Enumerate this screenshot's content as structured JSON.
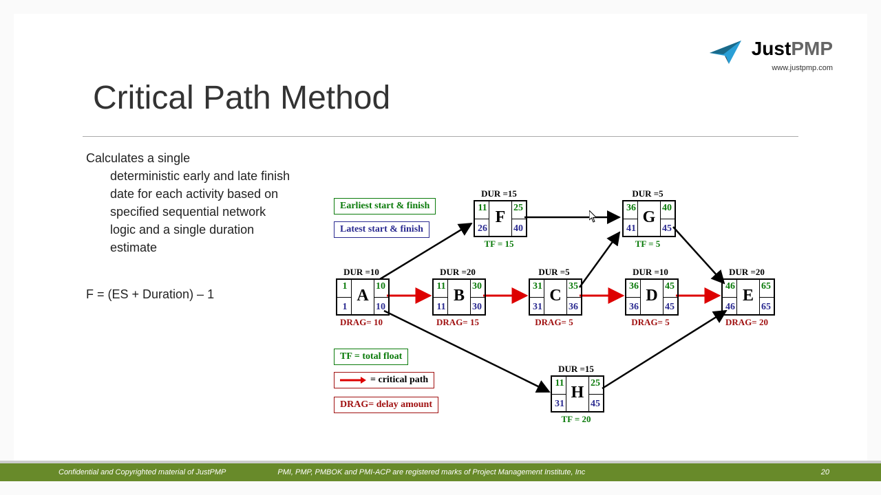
{
  "title": "Critical Path Method",
  "logo": {
    "brand1": "Just",
    "brand2": "PMP",
    "url": "www.justpmp.com"
  },
  "description": {
    "line1": "Calculates a single",
    "rest": "deterministic early and late finish date for each activity based on specified sequential network logic and a single duration estimate"
  },
  "formula": "F = (ES + Duration) – 1",
  "legends": {
    "earliest": "Earliest start & finish",
    "latest": "Latest start & finish",
    "tf": "TF = total float",
    "critical": " = critical path",
    "drag": "DRAG= delay amount"
  },
  "nodes": {
    "A": {
      "dur": "DUR =10",
      "es": "1",
      "ef": "10",
      "ls": "1",
      "lf": "10",
      "name": "A",
      "drag": "DRAG= 10"
    },
    "B": {
      "dur": "DUR =20",
      "es": "11",
      "ef": "30",
      "ls": "11",
      "lf": "30",
      "name": "B",
      "drag": "DRAG= 15"
    },
    "C": {
      "dur": "DUR =5",
      "es": "31",
      "ef": "35",
      "ls": "31",
      "lf": "36",
      "name": "C",
      "drag": "DRAG= 5"
    },
    "D": {
      "dur": "DUR =10",
      "es": "36",
      "ef": "45",
      "ls": "36",
      "lf": "45",
      "name": "D",
      "drag": "DRAG= 5"
    },
    "E": {
      "dur": "DUR =20",
      "es": "46",
      "ef": "65",
      "ls": "46",
      "lf": "65",
      "name": "E",
      "drag": "DRAG= 20"
    },
    "F": {
      "dur": "DUR =15",
      "es": "11",
      "ef": "25",
      "ls": "26",
      "lf": "40",
      "name": "F",
      "tf": "TF = 15"
    },
    "G": {
      "dur": "DUR =5",
      "es": "36",
      "ef": "40",
      "ls": "41",
      "lf": "45",
      "name": "G",
      "tf": "TF = 5"
    },
    "H": {
      "dur": "DUR =15",
      "es": "11",
      "ef": "25",
      "ls": "31",
      "lf": "45",
      "name": "H",
      "tf": "TF = 20"
    }
  },
  "footer": {
    "left": "Confidential and Copyrighted material of JustPMP",
    "center": "PMI, PMP, PMBOK and PMI-ACP are registered marks of Project Management Institute, Inc",
    "page": "20"
  }
}
